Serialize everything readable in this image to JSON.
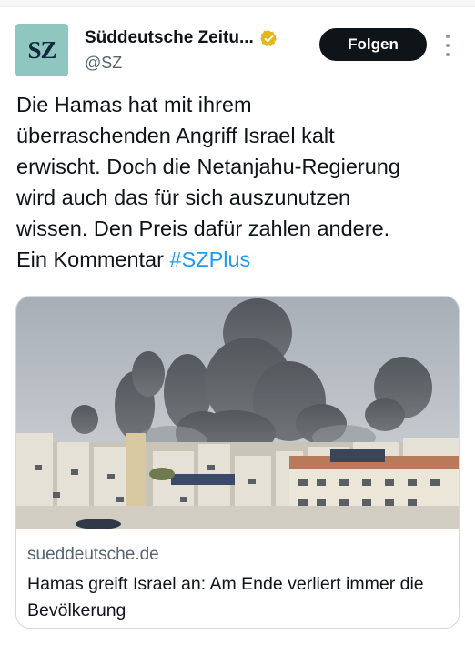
{
  "account": {
    "avatar_text": "SZ",
    "display_name": "Süddeutsche Zeitu...",
    "handle": "@SZ",
    "verified_icon": "gold-verified-badge-icon",
    "follow_label": "Folgen"
  },
  "tweet": {
    "text_lines": [
      "Die Hamas hat mit ihrem",
      "überraschenden Angriff Israel kalt",
      "erwischt. Doch die Netanjahu-Regierung",
      "wird auch das für sich auszunutzen",
      "wissen. Den Preis dafür zahlen andere.",
      "Ein Kommentar "
    ],
    "hashtag": "#SZPlus"
  },
  "link_card": {
    "domain": "sueddeutsche.de",
    "title": "Hamas greift Israel an: Am Ende verliert immer die Bevölkerung"
  },
  "colors": {
    "link_blue": "#1d9bf0",
    "avatar_bg": "#8fc7c0",
    "follow_bg": "#0f1419",
    "verified_gold": "#e2b719"
  }
}
